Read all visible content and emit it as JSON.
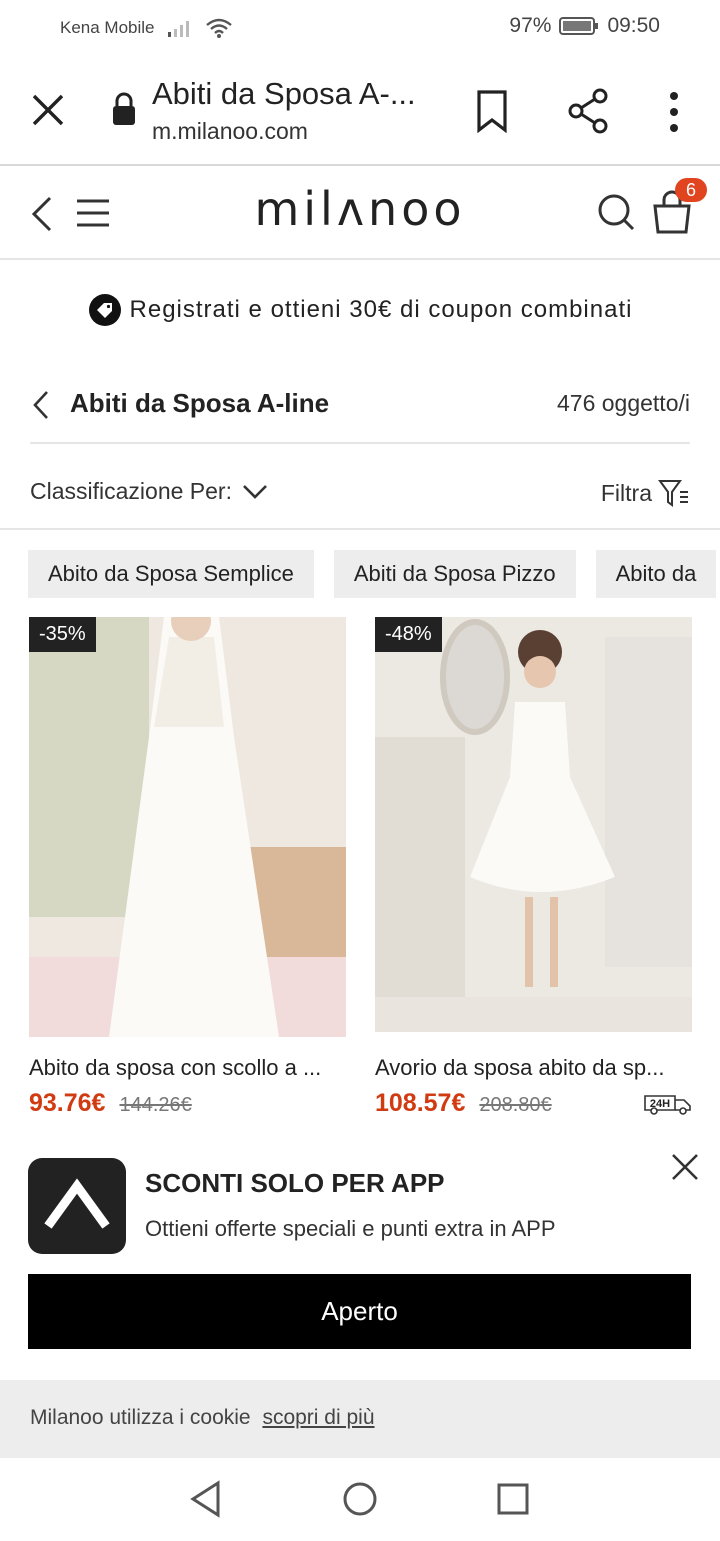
{
  "status_bar": {
    "carrier": "Kena Mobile",
    "battery": "97%",
    "time": "09:50"
  },
  "browser": {
    "title": "Abiti da Sposa A-...",
    "url": "m.milanoo.com"
  },
  "site_header": {
    "logo": "milʌnoo",
    "cart_count": "6"
  },
  "promo": {
    "text": "Registrati e ottieni 30€ di coupon combinati"
  },
  "category": {
    "title": "Abiti da Sposa A-line",
    "count": "476 oggetto/i"
  },
  "sort": {
    "label": "Classificazione Per:",
    "filter_label": "Filtra"
  },
  "chips": [
    "Abito da Sposa Semplice",
    "Abiti da Sposa Pizzo",
    "Abito da"
  ],
  "products": [
    {
      "discount": "-35%",
      "name": "Abito da sposa con scollo a ...",
      "price": "93.76€",
      "old_price": "144.26€"
    },
    {
      "discount": "-48%",
      "name": "Avorio da sposa abito da sp...",
      "price": "108.57€",
      "old_price": "208.80€",
      "delivery_badge": "24H"
    }
  ],
  "app_banner": {
    "title": "SCONTI SOLO PER APP",
    "subtitle": "Ottieni offerte speciali e punti extra in APP",
    "button": "Aperto"
  },
  "cookie": {
    "text": "Milanoo utilizza i cookie",
    "link": "scopri di più"
  },
  "colors": {
    "price": "#d13b12",
    "badge": "#e0451f",
    "button": "#000000"
  }
}
